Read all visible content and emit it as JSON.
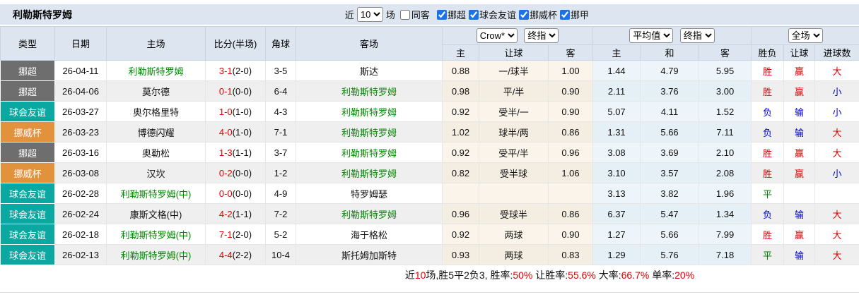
{
  "colors": {
    "red": "#e00000",
    "blue": "#0000dd",
    "green_team": "#008800",
    "green_draw": "#008000",
    "header_bg": "#dde6f0",
    "type_league": "#6e6e6e",
    "type_friendly": "#0aa8a0",
    "type_cup": "#e2913d"
  },
  "header": {
    "title": "利勒斯特罗姆",
    "near_label": "近",
    "matches_select": "10",
    "field_label": "场",
    "same_away_label": "同客",
    "filters": [
      {
        "label": "挪超",
        "checked": true
      },
      {
        "label": "球会友谊",
        "checked": true
      },
      {
        "label": "挪威杯",
        "checked": true
      },
      {
        "label": "挪甲",
        "checked": true
      }
    ]
  },
  "table": {
    "static_headers": [
      "类型",
      "日期",
      "主场",
      "比分(半场)",
      "角球",
      "客场"
    ],
    "odds_group": {
      "selects": [
        "Crow*",
        "终指"
      ],
      "cols": [
        "主",
        "让球",
        "客"
      ]
    },
    "avg_group": {
      "selects": [
        "平均值",
        "终指"
      ],
      "cols": [
        "主",
        "和",
        "客"
      ]
    },
    "result_group": {
      "selects": [
        "全场"
      ],
      "cols": [
        "胜负",
        "让球",
        "进球数"
      ]
    },
    "type_colors": {
      "挪超": "type_league",
      "球会友谊": "type_friendly",
      "挪威杯": "type_cup",
      "挪甲": "type_league"
    },
    "rows": [
      {
        "type": "挪超",
        "date": "26-04-11",
        "home": "利勒斯特罗姆",
        "home_green": true,
        "score": "3-1",
        "half": "(2-0)",
        "corner": "3-5",
        "away": "斯达",
        "away_green": false,
        "odds": [
          "0.88",
          "一/球半",
          "1.00"
        ],
        "avg": [
          "1.44",
          "4.79",
          "5.95"
        ],
        "res": [
          "胜",
          "赢",
          "大"
        ],
        "res_colors": [
          "red",
          "red",
          "red"
        ]
      },
      {
        "type": "挪超",
        "date": "26-04-06",
        "home": "莫尔德",
        "home_green": false,
        "score": "0-1",
        "half": "(0-0)",
        "corner": "6-4",
        "away": "利勒斯特罗姆",
        "away_green": true,
        "odds": [
          "0.98",
          "平/半",
          "0.90"
        ],
        "avg": [
          "2.11",
          "3.76",
          "3.00"
        ],
        "res": [
          "胜",
          "赢",
          "小"
        ],
        "res_colors": [
          "red",
          "red",
          "blue"
        ]
      },
      {
        "type": "球会友谊",
        "date": "26-03-27",
        "home": "奥尔格里特",
        "home_green": false,
        "score": "1-0",
        "half": "(1-0)",
        "corner": "4-3",
        "away": "利勒斯特罗姆",
        "away_green": true,
        "odds": [
          "0.92",
          "受半/一",
          "0.90"
        ],
        "avg": [
          "5.07",
          "4.11",
          "1.52"
        ],
        "res": [
          "负",
          "输",
          "小"
        ],
        "res_colors": [
          "blue",
          "blue",
          "blue"
        ]
      },
      {
        "type": "挪威杯",
        "date": "26-03-23",
        "home": "博德闪耀",
        "home_green": false,
        "score": "4-0",
        "half": "(1-0)",
        "corner": "7-1",
        "away": "利勒斯特罗姆",
        "away_green": true,
        "odds": [
          "1.02",
          "球半/两",
          "0.86"
        ],
        "avg": [
          "1.31",
          "5.66",
          "7.11"
        ],
        "res": [
          "负",
          "输",
          "大"
        ],
        "res_colors": [
          "blue",
          "blue",
          "red"
        ]
      },
      {
        "type": "挪超",
        "date": "26-03-16",
        "home": "奥勒松",
        "home_green": false,
        "score": "1-3",
        "half": "(1-1)",
        "corner": "3-7",
        "away": "利勒斯特罗姆",
        "away_green": true,
        "odds": [
          "0.92",
          "受平/半",
          "0.96"
        ],
        "avg": [
          "3.08",
          "3.69",
          "2.10"
        ],
        "res": [
          "胜",
          "赢",
          "大"
        ],
        "res_colors": [
          "red",
          "red",
          "red"
        ]
      },
      {
        "type": "挪威杯",
        "date": "26-03-08",
        "home": "汉坎",
        "home_green": false,
        "score": "0-2",
        "half": "(0-0)",
        "corner": "1-2",
        "away": "利勒斯特罗姆",
        "away_green": true,
        "odds": [
          "0.82",
          "受半球",
          "1.06"
        ],
        "avg": [
          "3.10",
          "3.57",
          "2.08"
        ],
        "res": [
          "胜",
          "赢",
          "小"
        ],
        "res_colors": [
          "red",
          "red",
          "blue"
        ]
      },
      {
        "type": "球会友谊",
        "date": "26-02-28",
        "home": "利勒斯特罗姆(中)",
        "home_green": true,
        "score": "0-0",
        "half": "(0-0)",
        "corner": "4-9",
        "away": "特罗姆瑟",
        "away_green": false,
        "odds": [
          "",
          "",
          ""
        ],
        "avg": [
          "3.13",
          "3.82",
          "1.96"
        ],
        "res": [
          "平",
          "",
          ""
        ],
        "res_colors": [
          "green",
          "",
          ""
        ]
      },
      {
        "type": "球会友谊",
        "date": "26-02-24",
        "home": "康斯文格(中)",
        "home_green": false,
        "score": "4-2",
        "half": "(1-1)",
        "corner": "7-2",
        "away": "利勒斯特罗姆",
        "away_green": true,
        "odds": [
          "0.96",
          "受球半",
          "0.86"
        ],
        "avg": [
          "6.37",
          "5.47",
          "1.34"
        ],
        "res": [
          "负",
          "输",
          "大"
        ],
        "res_colors": [
          "blue",
          "blue",
          "red"
        ]
      },
      {
        "type": "球会友谊",
        "date": "26-02-18",
        "home": "利勒斯特罗姆(中)",
        "home_green": true,
        "score": "7-1",
        "half": "(2-0)",
        "corner": "5-2",
        "away": "海于格松",
        "away_green": false,
        "odds": [
          "0.92",
          "两球",
          "0.90"
        ],
        "avg": [
          "1.27",
          "5.66",
          "7.99"
        ],
        "res": [
          "胜",
          "赢",
          "大"
        ],
        "res_colors": [
          "red",
          "red",
          "red"
        ]
      },
      {
        "type": "球会友谊",
        "date": "26-02-13",
        "home": "利勒斯特罗姆(中)",
        "home_green": true,
        "score": "4-4",
        "half": "(2-2)",
        "corner": "10-4",
        "away": "斯托姆加斯特",
        "away_green": false,
        "odds": [
          "0.93",
          "两球",
          "0.83"
        ],
        "avg": [
          "1.29",
          "5.76",
          "7.18"
        ],
        "res": [
          "平",
          "输",
          "大"
        ],
        "res_colors": [
          "green",
          "blue",
          "red"
        ]
      }
    ]
  },
  "footer": {
    "segments": [
      {
        "text": "近",
        "color": "black"
      },
      {
        "text": "10",
        "color": "red"
      },
      {
        "text": "场,胜5平2负3, 胜率:",
        "color": "black"
      },
      {
        "text": "50%",
        "color": "red"
      },
      {
        "text": " 让胜率:",
        "color": "black"
      },
      {
        "text": "55.6%",
        "color": "red"
      },
      {
        "text": " 大率:",
        "color": "black"
      },
      {
        "text": "66.7%",
        "color": "red"
      },
      {
        "text": " 单率:",
        "color": "black"
      },
      {
        "text": "20%",
        "color": "red"
      }
    ]
  }
}
